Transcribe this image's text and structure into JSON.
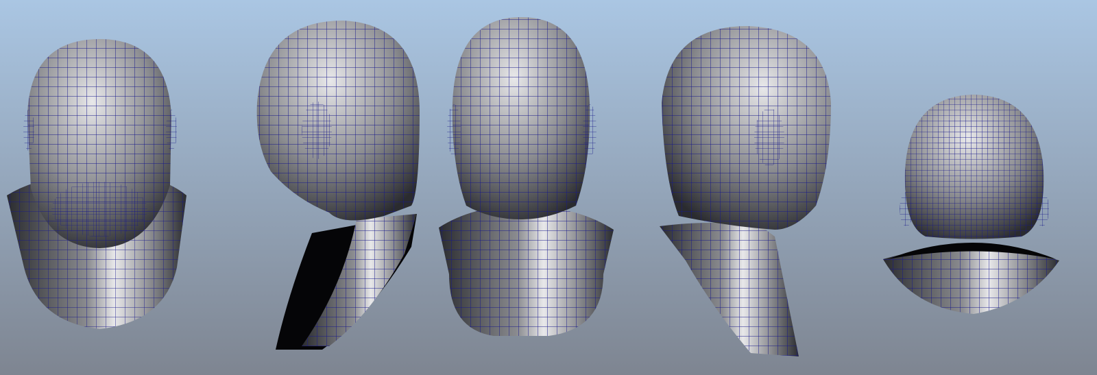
{
  "viewport": {
    "background_top": "#aac6e3",
    "background_bottom": "#7e8591",
    "wire_color": "#17188a",
    "surface_light": "#e8e8ea",
    "surface_mid": "#8b8c90",
    "surface_dark": "#2a2b2f",
    "inner_shadow": "#050507"
  },
  "views": [
    {
      "id": "top-down"
    },
    {
      "id": "left-rear-three-quarter"
    },
    {
      "id": "back"
    },
    {
      "id": "right-rear-three-quarter"
    },
    {
      "id": "bottom-up"
    }
  ]
}
